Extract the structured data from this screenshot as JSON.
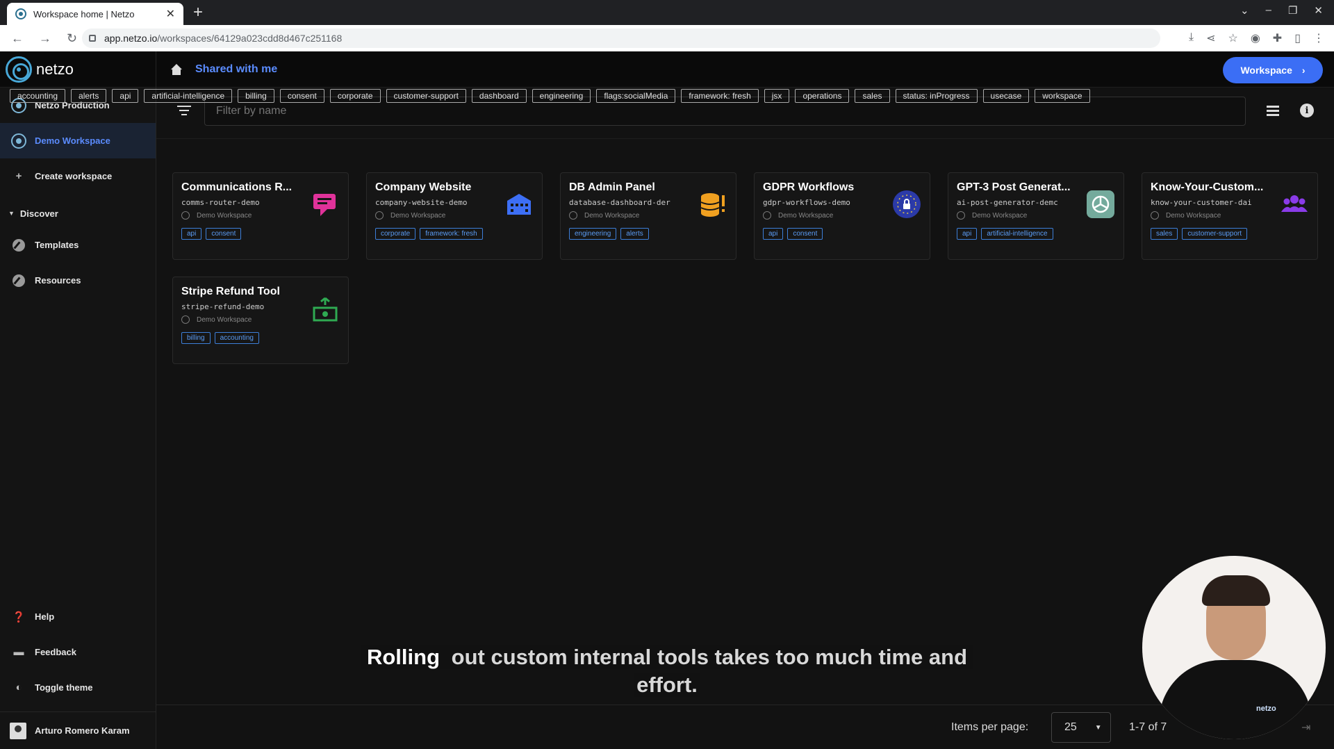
{
  "browser": {
    "tab_title": "Workspace home | Netzo",
    "url_host": "app.netzo.io",
    "url_path": "/workspaces/64129a023cdd8d467c251168"
  },
  "sidebar": {
    "logo": "netzo",
    "items": [
      {
        "label": "Netzo Production"
      },
      {
        "label": "Demo Workspace"
      },
      {
        "label": "Create workspace"
      }
    ],
    "discover_label": "Discover",
    "discover_items": [
      {
        "label": "Templates"
      },
      {
        "label": "Resources"
      }
    ],
    "bottom_items": [
      {
        "label": "Help"
      },
      {
        "label": "Feedback"
      },
      {
        "label": "Toggle theme"
      }
    ],
    "user": "Arturo Romero Karam"
  },
  "topbar": {
    "breadcrumb": "Shared with me",
    "workspace_button": "Workspace"
  },
  "filter": {
    "placeholder": "Filter by name"
  },
  "tags": [
    "accounting",
    "alerts",
    "api",
    "artificial-intelligence",
    "billing",
    "consent",
    "corporate",
    "customer-support",
    "dashboard",
    "engineering",
    "flags:socialMedia",
    "framework: fresh",
    "jsx",
    "operations",
    "sales",
    "status: inProgress",
    "usecase",
    "workspace"
  ],
  "cards": [
    {
      "title": "Communications R...",
      "slug": "comms-router-demo",
      "workspace": "Demo Workspace",
      "tags": [
        "api",
        "consent"
      ],
      "icon": "chat-icon",
      "icon_color": "#e0329a"
    },
    {
      "title": "Company Website",
      "slug": "company-website-demo",
      "workspace": "Demo Workspace",
      "tags": [
        "corporate",
        "framework: fresh"
      ],
      "icon": "building-icon",
      "icon_color": "#3d6ff5"
    },
    {
      "title": "DB Admin Panel",
      "slug": "database-dashboard-der",
      "workspace": "Demo Workspace",
      "tags": [
        "engineering",
        "alerts"
      ],
      "icon": "database-alert-icon",
      "icon_color": "#f0a020"
    },
    {
      "title": "GDPR Workflows",
      "slug": "gdpr-workflows-demo",
      "workspace": "Demo Workspace",
      "tags": [
        "api",
        "consent"
      ],
      "icon": "eu-lock-icon",
      "icon_color": "#2b3aa8"
    },
    {
      "title": "GPT-3 Post Generat...",
      "slug": "ai-post-generator-demc",
      "workspace": "Demo Workspace",
      "tags": [
        "api",
        "artificial-intelligence"
      ],
      "icon": "openai-icon",
      "icon_color": "#74aa9c"
    },
    {
      "title": "Know-Your-Custom...",
      "slug": "know-your-customer-dai",
      "workspace": "Demo Workspace",
      "tags": [
        "sales",
        "customer-support"
      ],
      "icon": "people-icon",
      "icon_color": "#8a3be8"
    },
    {
      "title": "Stripe Refund Tool",
      "slug": "stripe-refund-demo",
      "workspace": "Demo Workspace",
      "tags": [
        "billing",
        "accounting"
      ],
      "icon": "cash-refund-icon",
      "icon_color": "#2faa52"
    }
  ],
  "pager": {
    "items_per_page_label": "Items per page:",
    "per_page": "25",
    "range": "1-7 of 7"
  },
  "caption": {
    "highlight": "Rolling",
    "line1_rest": "out custom internal tools takes too much time and",
    "line2": "effort."
  },
  "webcam_badge": "netzo"
}
